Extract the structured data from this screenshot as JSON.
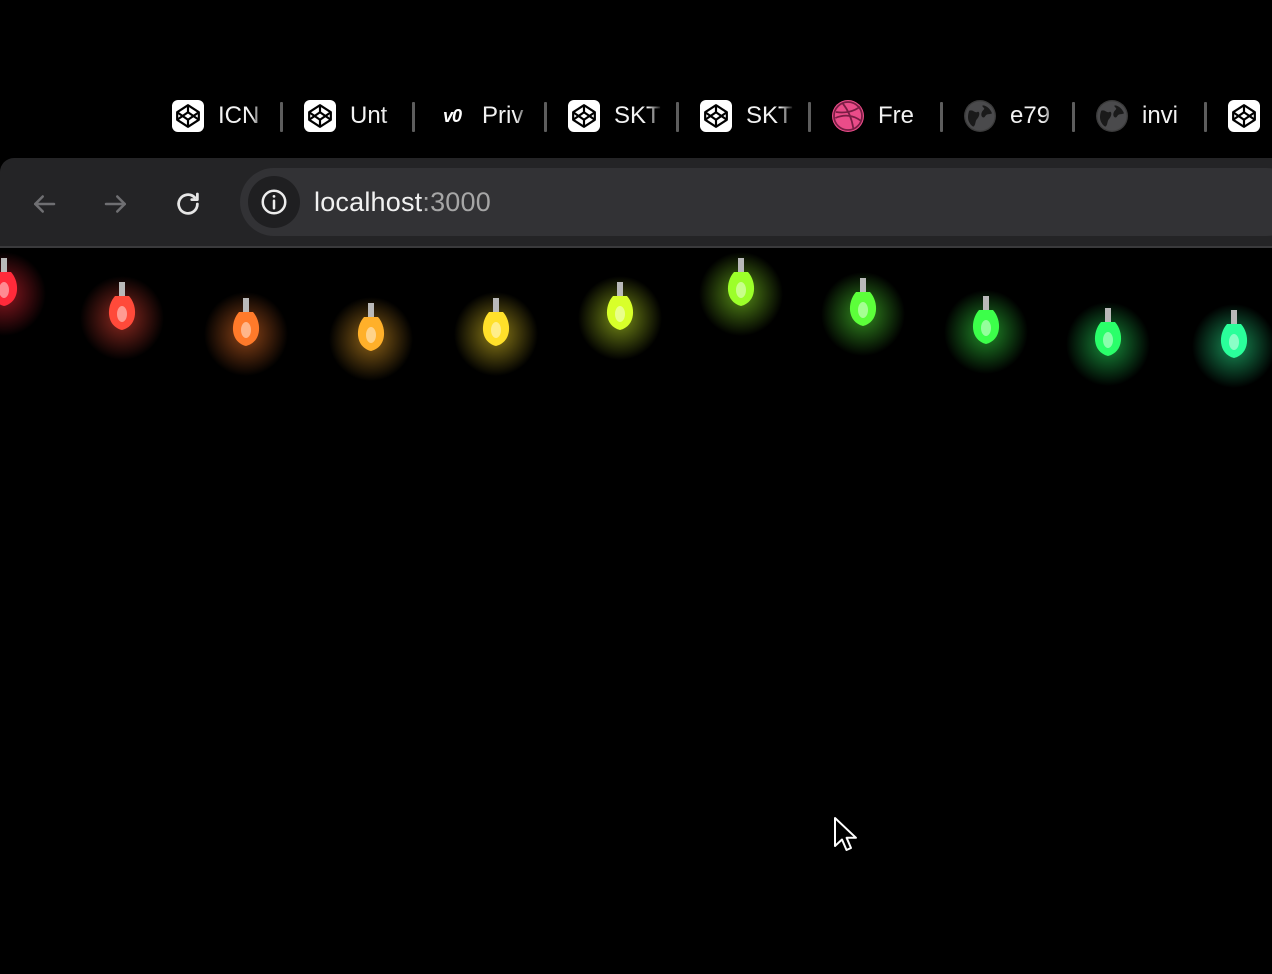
{
  "tabs": [
    {
      "title": "ICN",
      "icon": "codepen-icon"
    },
    {
      "title": "Unt",
      "icon": "codepen-icon"
    },
    {
      "title": "Priv",
      "icon": "v0-icon",
      "icon_text": "v0"
    },
    {
      "title": "SKT",
      "icon": "codepen-icon"
    },
    {
      "title": "SKT",
      "icon": "codepen-icon"
    },
    {
      "title": "Fre",
      "icon": "dribbble-icon"
    },
    {
      "title": "e79",
      "icon": "globe-icon"
    },
    {
      "title": "invi",
      "icon": "globe-icon"
    },
    {
      "title": "",
      "icon": "codepen-icon"
    }
  ],
  "toolbar": {
    "back_icon": "arrow-left-icon",
    "forward_icon": "arrow-right-icon",
    "reload_icon": "reload-icon",
    "site_info_icon": "info-icon"
  },
  "address_bar": {
    "host": "localhost",
    "port": ":3000"
  },
  "colors": {
    "page_background": "#000000",
    "toolbar_background": "#242426",
    "omnibox_background": "#323235",
    "codepen_favicon": "#ffffff",
    "dribbble_favicon": "#ea4c89"
  },
  "string_lights": {
    "bulb_colors": [
      "#ff2a3a",
      "#ff4a3a",
      "#ff7a2a",
      "#ffb02a",
      "#ffe02a",
      "#d8ff2a",
      "#9cff2a",
      "#5cff3a",
      "#3cff4a",
      "#2aff6a",
      "#2aff9a"
    ]
  }
}
